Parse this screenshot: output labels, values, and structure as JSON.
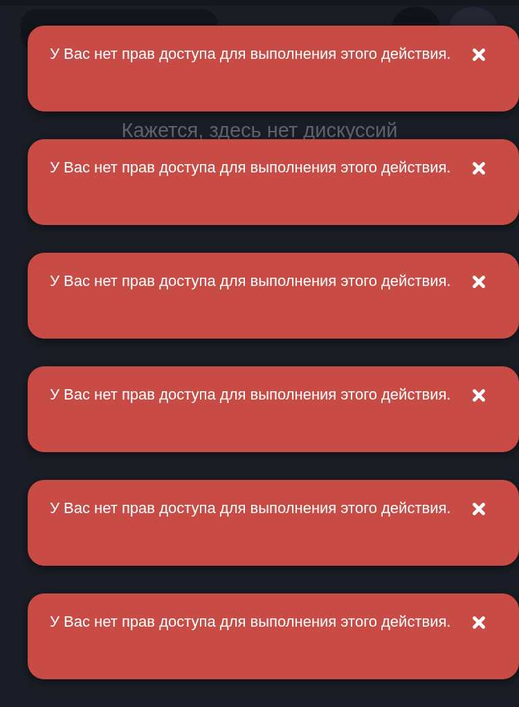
{
  "empty_state": {
    "message": "Кажется, здесь нет дискуссий"
  },
  "toasts": [
    {
      "kind": "error",
      "message": "У Вас нет прав доступа для выполнения этого действия."
    },
    {
      "kind": "error",
      "message": "У Вас нет прав доступа для выполнения этого действия."
    },
    {
      "kind": "error",
      "message": "У Вас нет прав доступа для выполнения этого действия."
    },
    {
      "kind": "error",
      "message": "У Вас нет прав доступа для выполнения этого действия."
    },
    {
      "kind": "error",
      "message": "У Вас нет прав доступа для выполнения этого действия."
    },
    {
      "kind": "error",
      "message": "У Вас нет прав доступа для выполнения этого действия."
    }
  ]
}
